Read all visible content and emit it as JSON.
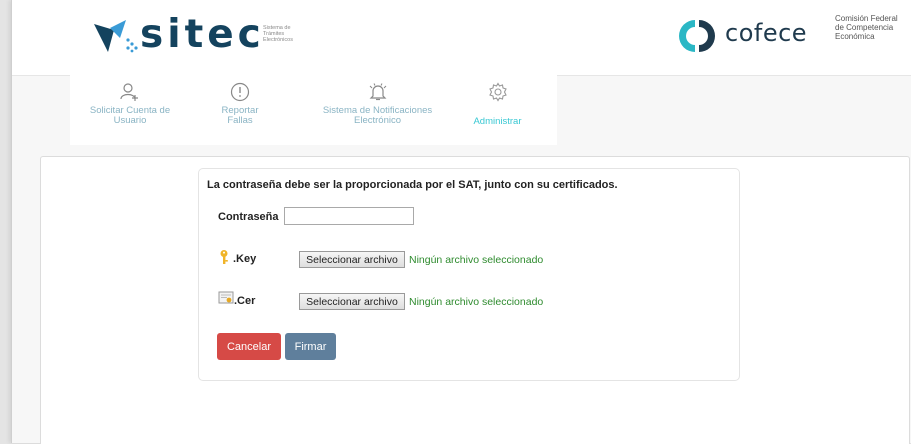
{
  "header": {
    "sitec_name": "sitec",
    "sitec_subtitle": "Sistema de Trámites Electrónicos",
    "cofece_name": "cofece",
    "cofece_subtitle": "Comisión Federal de Competencia Económica",
    "colors": {
      "sitec_dark": "#14435e",
      "sitec_light": "#3a9bd6",
      "cofece_teal": "#2bb7c5"
    }
  },
  "nav": {
    "items": [
      {
        "label": "Solicitar Cuenta de Usuario",
        "icon": "add-user-icon"
      },
      {
        "label": "Reportar Fallas",
        "icon": "alert-circle-icon"
      },
      {
        "label": "Sistema de Notificaciones Electrónico",
        "icon": "bell-icon"
      },
      {
        "label": "Administrar",
        "icon": "gear-icon",
        "active": true
      }
    ]
  },
  "form": {
    "notice": "La contraseña debe ser la proporcionada por el SAT, junto con su certificados.",
    "password_label": "Contraseña",
    "password_value": "",
    "key_label": ".Key",
    "key_icon": "key-icon",
    "cer_label": ".Cer",
    "cer_icon": "certificate-icon",
    "file_button_label": "Seleccionar archivo",
    "key_file_status": "Ningún archivo seleccionado",
    "cer_file_status": "Ningún archivo seleccionado",
    "cancel_label": "Cancelar",
    "sign_label": "Firmar",
    "colors": {
      "cancel": "#d64a46",
      "sign": "#5f7f9c",
      "status": "#2e8b2e"
    }
  }
}
